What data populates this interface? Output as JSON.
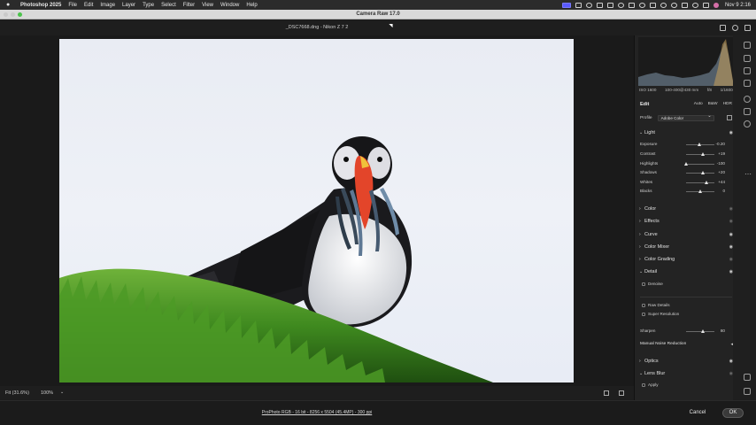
{
  "menubar": {
    "app_name": "Photoshop 2025",
    "items": [
      "File",
      "Edit",
      "Image",
      "Layer",
      "Type",
      "Select",
      "Filter",
      "View",
      "Window",
      "Help"
    ],
    "clock": "Nov 9  2:16"
  },
  "window": {
    "title": "Camera Raw 17.0"
  },
  "file": {
    "title": "_DSC7668.dng  -  Nikon Z 7 2"
  },
  "camera_info": {
    "iso": "ISO 1600",
    "lens": "100-400@430 mm",
    "aperture": "f/8",
    "shutter": "1/1600s"
  },
  "edit": {
    "heading": "Edit",
    "options": [
      "Auto",
      "B&W",
      "HDR"
    ],
    "profile_label": "Profile",
    "profile_value": "Adobe Color"
  },
  "light": {
    "title": "Light",
    "sliders": [
      {
        "label": "Exposure",
        "value": "-0.20",
        "pos": 0.48
      },
      {
        "label": "Contrast",
        "value": "+19",
        "pos": 0.6
      },
      {
        "label": "Highlights",
        "value": "-100",
        "pos": 0.0
      },
      {
        "label": "Shadows",
        "value": "+20",
        "pos": 0.6
      },
      {
        "label": "Whites",
        "value": "+44",
        "pos": 0.72
      },
      {
        "label": "Blacks",
        "value": "0",
        "pos": 0.5
      }
    ]
  },
  "sections": [
    "Color",
    "Effects",
    "Curve",
    "Color Mixer",
    "Color Grading"
  ],
  "detail": {
    "title": "Detail",
    "denoise": "Denoise",
    "raw_details": "Raw Details",
    "super_resolution": "Super Resolution",
    "sharpen_label": "Sharpen",
    "sharpen_value": "80",
    "sharpen_pos": 0.6,
    "manual_nr": "Manual Noise Reduction"
  },
  "optics": {
    "title": "Optics"
  },
  "lens_blur": {
    "title": "Lens Blur",
    "apply": "Apply"
  },
  "bottom": {
    "fit": "Fit (31.6%)",
    "zoom": "100%"
  },
  "status": {
    "workflow": "ProPhoto RGB - 16 bit - 8256 x 5504 (45.4MP) - 300 ppi",
    "cancel": "Cancel",
    "ok": "OK"
  },
  "colors": {
    "panel_bg": "#232323",
    "accent": "#5a5aff",
    "beak": "#e3452a"
  }
}
